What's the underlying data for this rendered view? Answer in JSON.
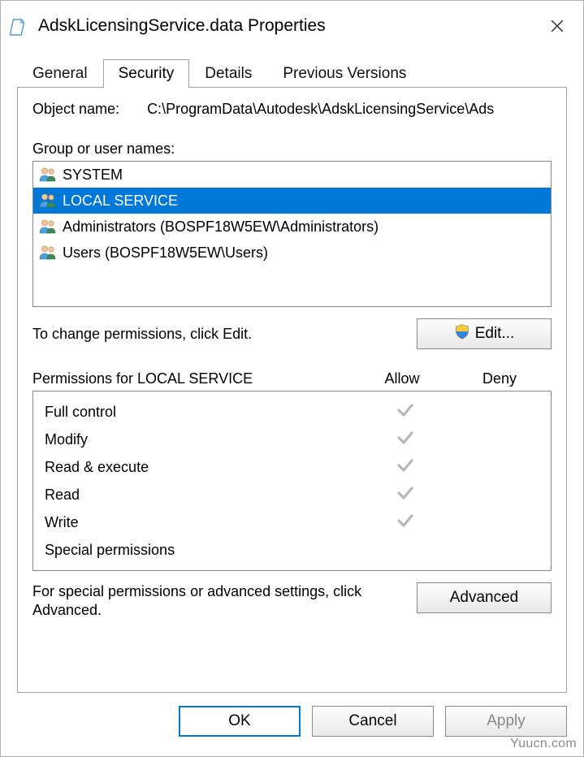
{
  "window": {
    "title": "AdskLicensingService.data Properties"
  },
  "tabs": {
    "general": "General",
    "security": "Security",
    "details": "Details",
    "previous": "Previous Versions",
    "active": "security"
  },
  "object": {
    "label": "Object name:",
    "value": "C:\\ProgramData\\Autodesk\\AdskLicensingService\\Ads"
  },
  "group_section": {
    "label": "Group or user names:",
    "items": [
      {
        "label": "SYSTEM",
        "selected": false
      },
      {
        "label": "LOCAL SERVICE",
        "selected": true
      },
      {
        "label": "Administrators (BOSPF18W5EW\\Administrators)",
        "selected": false
      },
      {
        "label": "Users (BOSPF18W5EW\\Users)",
        "selected": false
      }
    ]
  },
  "edit_hint": "To change permissions, click Edit.",
  "edit_button": "Edit...",
  "perm_section": {
    "title": "Permissions for LOCAL SERVICE",
    "allow_header": "Allow",
    "deny_header": "Deny",
    "rows": [
      {
        "name": "Full control",
        "allow": true,
        "deny": false
      },
      {
        "name": "Modify",
        "allow": true,
        "deny": false
      },
      {
        "name": "Read & execute",
        "allow": true,
        "deny": false
      },
      {
        "name": "Read",
        "allow": true,
        "deny": false
      },
      {
        "name": "Write",
        "allow": true,
        "deny": false
      },
      {
        "name": "Special permissions",
        "allow": false,
        "deny": false
      }
    ]
  },
  "advanced_hint": "For special permissions or advanced settings, click Advanced.",
  "advanced_button": "Advanced",
  "buttons": {
    "ok": "OK",
    "cancel": "Cancel",
    "apply": "Apply"
  },
  "watermark": "Yuucn.com"
}
